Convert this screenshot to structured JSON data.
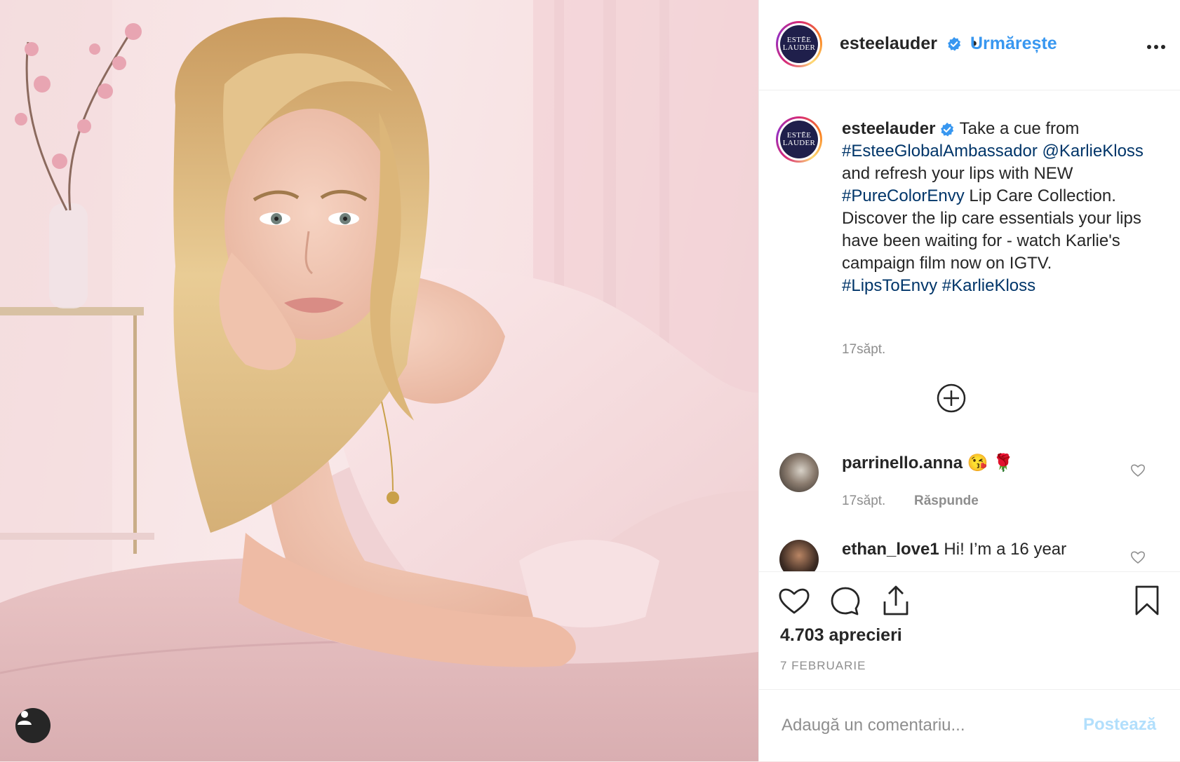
{
  "post": {
    "photo_alt": "",
    "user_tag_icon": "person-icon"
  },
  "header": {
    "username": "esteelauder",
    "separator": "•",
    "follow_label": "Urmărește",
    "avatar_logo_line1": "ESTĒE",
    "avatar_logo_line2": "LAUDER"
  },
  "caption": {
    "username": "esteelauder",
    "text_1": " Take a cue from ",
    "tag_1": "#EsteeGlobalAmbassador",
    "mention": "@KarlieKloss",
    "text_2": " and refresh your lips with NEW ",
    "tag_2": "#PureColorEnvy",
    "text_3": " Lip Care Collection. Discover the lip care essentials your lips have been waiting for - watch Karlie's campaign film now on IGTV. ",
    "tag_3": "#LipsToEnvy",
    "tag_4": "#KarlieKloss",
    "time": "17săpt."
  },
  "comments": [
    {
      "username": "parrinello.anna",
      "text": " 😘 🌹",
      "time": "17săpt.",
      "reply_label": "Răspunde"
    },
    {
      "username": "ethan_love1",
      "text": " Hi! I’m a 16 year"
    }
  ],
  "stats": {
    "likes": "4.703 aprecieri",
    "date": "7 FEBRUARIE"
  },
  "comment_box": {
    "placeholder": "Adaugă un comentariu...",
    "post_label": "Postează"
  },
  "colors": {
    "link_blue": "#3897f0",
    "hashtag": "#003569",
    "verified": "#3897f0",
    "muted": "#8e8e8e",
    "post_disabled": "#b2dffc"
  }
}
